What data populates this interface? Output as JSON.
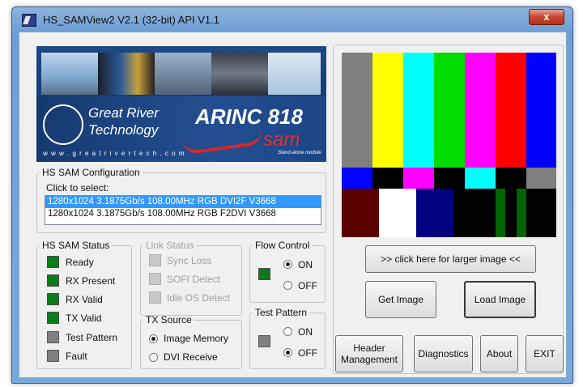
{
  "window": {
    "title": "HS_SAMView2  V2.1 (32-bit)   API V1.1",
    "close_label": "x"
  },
  "banner": {
    "company_line1": "Great River",
    "company_line2": "Technology",
    "url": "w w w . g r e a t r i v e r t e c h . c o m",
    "product": "ARINC 818",
    "product_sub": "sam",
    "tagline": "Stand-alone module"
  },
  "config": {
    "legend": "HS SAM Configuration",
    "prompt": "Click to select:",
    "options": [
      "1280x1024 3.1875Gb/s 108.00MHz RGB DVI2F V3668",
      "1280x1024 3.1875Gb/s 108.00MHz RGB F2DVI V3668"
    ],
    "selected_index": 0
  },
  "status": {
    "legend": "HS SAM Status",
    "items": [
      {
        "label": "Ready",
        "state": "green"
      },
      {
        "label": "RX Present",
        "state": "green"
      },
      {
        "label": "RX Valid",
        "state": "green"
      },
      {
        "label": "TX Valid",
        "state": "green"
      },
      {
        "label": "Test Pattern",
        "state": "gray"
      },
      {
        "label": "Fault",
        "state": "gray"
      }
    ]
  },
  "link": {
    "legend": "Link Status",
    "items": [
      "Sync Loss",
      "SOFI Detect",
      "Idle OS Detect"
    ]
  },
  "flow": {
    "legend": "Flow Control",
    "on": "ON",
    "off": "OFF",
    "selected": "ON"
  },
  "tx": {
    "legend": "TX Source",
    "opt1": "Image Memory",
    "opt2": "DVI Receive",
    "selected": "Image Memory"
  },
  "test": {
    "legend": "Test Pattern",
    "on": "ON",
    "off": "OFF",
    "selected": "OFF"
  },
  "buttons": {
    "larger": ">> click here for larger image <<",
    "get": "Get Image",
    "load": "Load Image",
    "header1": "Header",
    "header2": "Management",
    "diag": "Diagnostics",
    "about": "About",
    "exit": "EXIT"
  },
  "colors": {
    "green_led": "#0a7d1a",
    "gray_led": "#808080",
    "selected_row": "#3399ff"
  }
}
